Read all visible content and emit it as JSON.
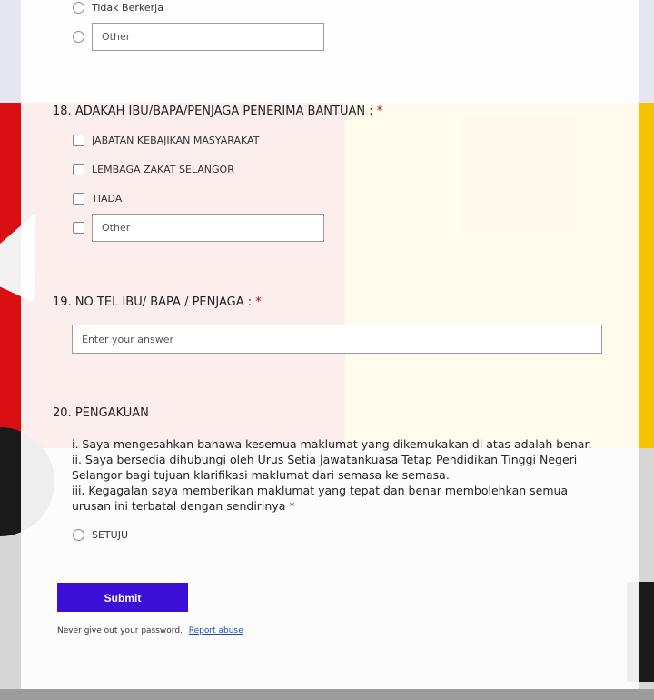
{
  "q17": {
    "options": [
      "Tidak Berkerja"
    ],
    "other_placeholder": "Other"
  },
  "q18": {
    "number": "18.",
    "title": "ADAKAH IBU/BAPA/PENJAGA PENERIMA BANTUAN  : ",
    "required_mark": "*",
    "options": [
      "JABATAN KEBAJIKAN MASYARAKAT",
      "LEMBAGA ZAKAT SELANGOR",
      "TIADA"
    ],
    "other_placeholder": "Other"
  },
  "q19": {
    "number": "19.",
    "title": "NO TEL IBU/ BAPA / PENJAGA  : ",
    "required_mark": "*",
    "placeholder": "Enter your answer"
  },
  "q20": {
    "number": "20.",
    "title": "PENGAKUAN",
    "lines": [
      "i. Saya mengesahkan bahawa kesemua maklumat yang dikemukakan di atas adalah benar.",
      "ii. Saya bersedia dihubungi oleh Urus Setia Jawatankuasa Tetap Pendidikan Tinggi Negeri Selangor  bagi tujuan klarifikasi maklumat dari semasa ke semasa.",
      "iii. Kegagalan saya memberikan maklumat yang tepat dan benar membolehkan semua urusan ini terbatal dengan sendirinya "
    ],
    "required_mark": "*",
    "option": "SETUJU"
  },
  "submit_label": "Submit",
  "footer": {
    "text": "Never give out your password.",
    "link": "Report abuse"
  },
  "colors": {
    "accent": "#3c0fd6",
    "required": "#c00000"
  }
}
